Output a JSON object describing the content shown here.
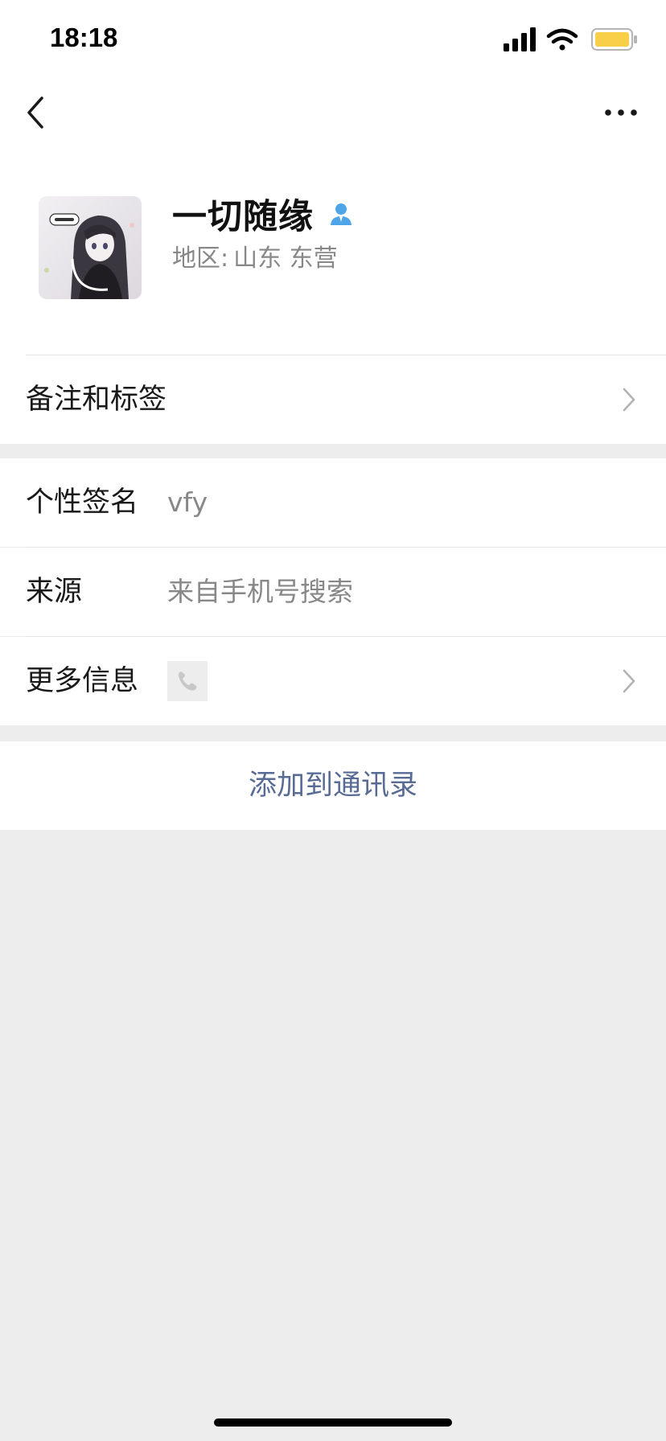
{
  "status_bar": {
    "time": "18:18",
    "battery_color": "#f7cf48",
    "icons": [
      "signal-icon",
      "wifi-icon",
      "battery-icon"
    ]
  },
  "nav": {
    "back_icon": "chevron-left-icon",
    "more_icon": "more-dots-icon"
  },
  "profile": {
    "name": "一切随缘",
    "gender_icon": "male-user-icon",
    "gender_color": "#4ea5e8",
    "region_label": "地区:",
    "region_value": "山东 东营",
    "avatar_icon": "anime-avatar-icon"
  },
  "rows": {
    "remark": {
      "label": "备注和标签"
    },
    "signature": {
      "label": "个性签名",
      "value": "vfy"
    },
    "source": {
      "label": "来源",
      "value": "来自手机号搜索"
    },
    "more_info": {
      "label": "更多信息",
      "icon": "phone-icon"
    }
  },
  "actions": {
    "add_contact": "添加到通讯录"
  },
  "colors": {
    "link": "#576b95",
    "background": "#ededed"
  }
}
